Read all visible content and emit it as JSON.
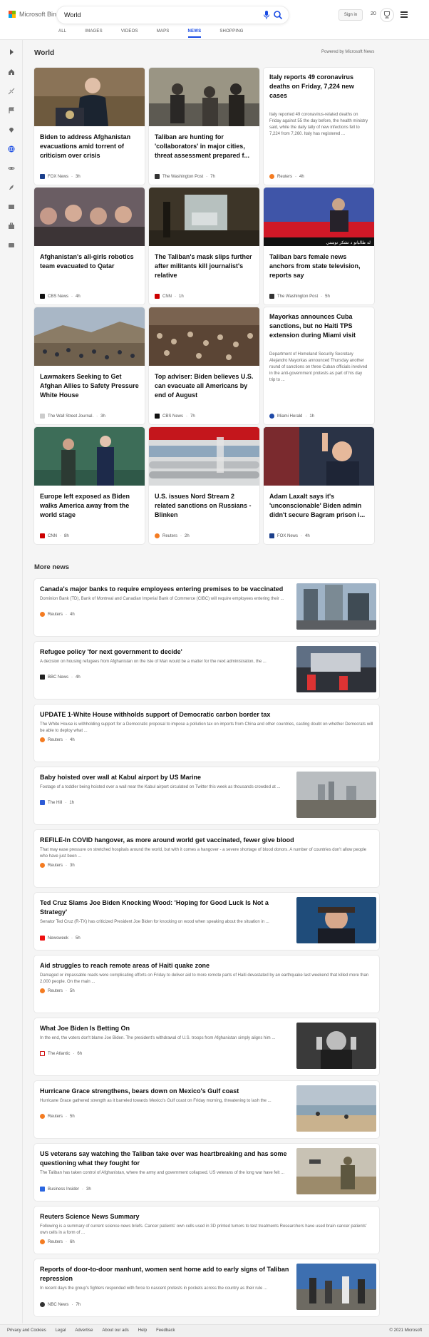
{
  "brand": {
    "name": "Microsoft Bing"
  },
  "search": {
    "query": "World"
  },
  "header": {
    "signin_label": "Sign in",
    "rewards_count": "20"
  },
  "scopes": [
    "ALL",
    "IMAGES",
    "VIDEOS",
    "MAPS",
    "NEWS",
    "SHOPPING"
  ],
  "section": {
    "title": "World",
    "powered": "Powered by Microsoft News",
    "more_title": "More news"
  },
  "cards": [
    {
      "title": "Biden to address Afghanistan evacuations amid torrent of criticism over crisis",
      "source": "FOX News",
      "time": "3h"
    },
    {
      "title": "Taliban are hunting for 'collaborators' in major cities, threat assessment prepared f...",
      "source": "The Washington Post",
      "time": "7h"
    },
    {
      "title": "Italy reports 49 coronavirus deaths on Friday, 7,224 new cases",
      "snippet": "Italy reported 49 coronavirus-related deaths on Friday against 55 the day before, the health ministry said, while the daily tally of new infections fell to 7,224 from 7,260. Italy has registered ...",
      "source": "Reuters",
      "time": "4h"
    },
    {
      "title": "Afghanistan's all-girls robotics team evacuated to Qatar",
      "source": "CBS News",
      "time": "4h"
    },
    {
      "title": "The Taliban's mask slips further after militants kill journalist's relative",
      "source": "CNN",
      "time": "1h"
    },
    {
      "title": "Taliban bars female news anchors from state television, reports say",
      "source": "The Washington Post",
      "time": "5h"
    },
    {
      "title": "Lawmakers Seeking to Get Afghan Allies to Safety Pressure White House",
      "source": "The Wall Street Journal.",
      "time": "3h"
    },
    {
      "title": "Top adviser: Biden believes U.S. can evacuate all Americans by end of August",
      "source": "CBS News",
      "time": "7h"
    },
    {
      "title": "Mayorkas announces Cuba sanctions, but no Haiti TPS extension during Miami visit",
      "snippet": "Department of Homeland Security Secretary Alejandro Mayorkas announced Thursday another round of sanctions on three Cuban officials involved in the anti-government protests as part of his day trip to ...",
      "source": "Miami Herald",
      "time": "1h"
    },
    {
      "title": "Europe left exposed as Biden walks America away from the world stage",
      "source": "CNN",
      "time": "8h"
    },
    {
      "title": "U.S. issues Nord Stream 2 related sanctions on Russians - Blinken",
      "source": "Reuters",
      "time": "2h"
    },
    {
      "title": "Adam Laxalt says it's 'unconscionable' Biden admin didn't secure Bagram prison i...",
      "source": "FOX News",
      "time": "4h"
    }
  ],
  "image_captions": {
    "anchor_overlay": "له طالبانو د تشکر نوښتي"
  },
  "more_news": [
    {
      "title": "Canada's major banks to require employees entering premises to be vaccinated",
      "snippet": "Dominion Bank (TD), Bank of Montreal and Canadian Imperial Bank of Commerce (CIBC) will require employees entering their ...",
      "source": "Reuters",
      "time": "4h"
    },
    {
      "title": "Refugee policy 'for next government to decide'",
      "snippet": "A decision on housing refugees from Afghanistan on the Isle of Man would be a matter for the next administration, the ...",
      "source": "BBC News",
      "time": "4h"
    },
    {
      "title": "UPDATE 1-White House withholds support of Democratic carbon border tax",
      "snippet": "The White House is withholding support for a Democratic proposal to impose a pollution tax on imports from China and other countries, casting doubt on whether Democrats will be able to deploy what ...",
      "source": "Reuters",
      "time": "4h"
    },
    {
      "title": "Baby hoisted over wall at Kabul airport by US Marine",
      "snippet": "Footage of a toddler being hoisted over a wall near the Kabul airport circulated on Twitter this week as thousands crowded at ...",
      "source": "The Hill",
      "time": "1h"
    },
    {
      "title": "REFILE-In COVID hangover, as more around world get vaccinated, fewer give blood",
      "snippet": "That may ease pressure on stretched hospitals around the world, but with it comes a hangover - a severe shortage of blood donors. A number of countries don't allow people who have just been ...",
      "source": "Reuters",
      "time": "3h"
    },
    {
      "title": "Ted Cruz Slams Joe Biden Knocking Wood: 'Hoping for Good Luck Is Not a Strategy'",
      "snippet": "Senator Ted Cruz (R-TX) has criticized President Joe Biden for knocking on wood when speaking about the situation in ...",
      "source": "Newsweek",
      "time": "5h"
    },
    {
      "title": "Aid struggles to reach remote areas of Haiti quake zone",
      "snippet": "Damaged or impassable roads were complicating efforts on Friday to deliver aid to more remote parts of Haiti devastated by an earthquake last weekend that killed more than 2,000 people. On the main ...",
      "source": "Reuters",
      "time": "5h"
    },
    {
      "title": "What Joe Biden Is Betting On",
      "snippet": "In the end, the voters don't blame Joe Biden. The president's withdrawal of U.S. troops from Afghanistan simply aligns him ...",
      "source": "The Atlantic",
      "time": "6h"
    },
    {
      "title": "Hurricane Grace strengthens, bears down on Mexico's Gulf coast",
      "snippet": "Hurricane Grace gathered strength as it barreled towards Mexico's Gulf coast on Friday morning, threatening to lash the ...",
      "source": "Reuters",
      "time": "5h"
    },
    {
      "title": "US veterans say watching the Taliban take over was heartbreaking and has some questioning what they fought for",
      "snippet": "The Taliban has taken control of Afghanistan, where the army and government collapsed. US veterans of the long war have felt ...",
      "source": "Business Insider",
      "time": "3h"
    },
    {
      "title": "Reuters Science News Summary",
      "snippet": "Following is a summary of current science news briefs. Cancer patients' own cells used in 3D printed tumors to test treatments Researchers have used brain cancer patients' own cells in a form of ...",
      "source": "Reuters",
      "time": "6h"
    },
    {
      "title": "Reports of door-to-door manhunt, women sent home add to early signs of Taliban repression",
      "snippet": "In recent days the group's fighters responded with force to nascent protests in pockets across the country as their rule ...",
      "source": "NBC News",
      "time": "7h"
    }
  ],
  "footer": {
    "links": [
      "Privacy and Cookies",
      "Legal",
      "Advertise",
      "About our ads",
      "Help",
      "Feedback"
    ],
    "copyright": "© 2021 Microsoft"
  },
  "colors": {
    "accent": "#174ae4",
    "reuters": "#f47c22",
    "cnn": "#cc0000",
    "fox": "#1b3f8b"
  }
}
